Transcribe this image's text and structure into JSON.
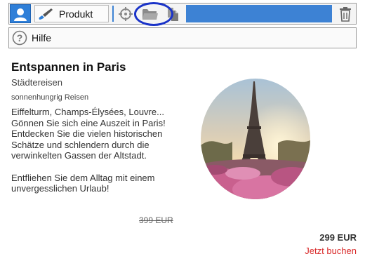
{
  "toolbar": {
    "icons": [
      "user-avatar-icon",
      "brush-icon",
      "crosshair-icon",
      "folder-open-icon",
      "copy-pages-icon",
      "trash-icon"
    ],
    "produkt_label": "Produkt",
    "highlight_color": "#1a33c8",
    "field_color": "#3d82d4"
  },
  "help": {
    "label": "Hilfe",
    "icon": "help-circle-icon"
  },
  "product": {
    "title": "Entspannen in Paris",
    "category": "Städtereisen",
    "vendor": "sonnenhungrig Reisen",
    "description_1": "Eiffelturm, Champs-Élysées, Louvre... Gönnen Sie sich eine Auszeit in Paris! Entdecken Sie die vielen historischen Schätze und schlendern durch die verwinkelten Gassen der Altstadt.",
    "description_2": "Entfliehen Sie dem Alltag mit einem unvergesslichen Urlaub!",
    "old_price": "399 EUR",
    "price": "299 EUR",
    "book_label": "Jetzt buchen",
    "book_color": "#d92b2b",
    "image": "eiffel-tower-photo"
  }
}
